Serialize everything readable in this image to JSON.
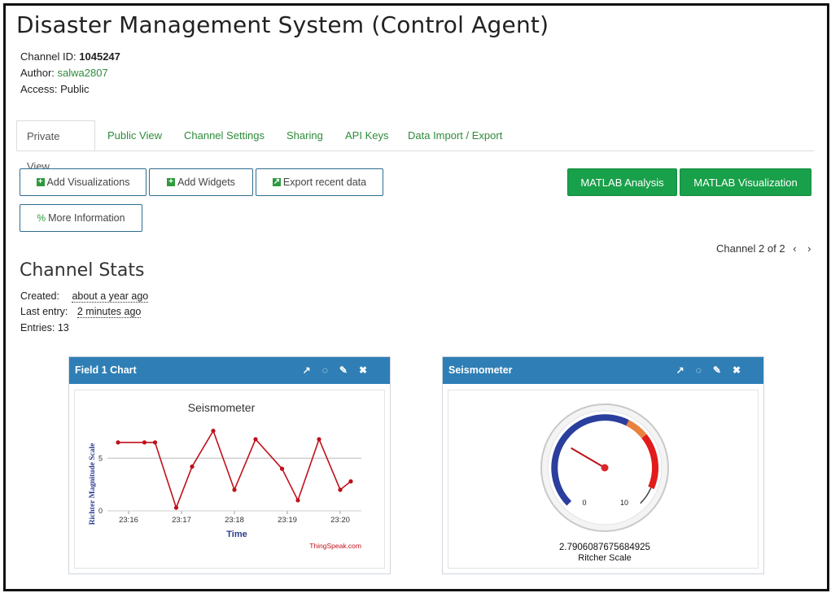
{
  "page": {
    "title": "Disaster Management System (Control Agent)",
    "channel_id_label": "Channel ID:",
    "channel_id": "1045247",
    "author_label": "Author:",
    "author": "salwa2807",
    "access": "Access: Public"
  },
  "tabs": [
    {
      "label": "Private View",
      "active": true
    },
    {
      "label": "Public View"
    },
    {
      "label": "Channel Settings"
    },
    {
      "label": "Sharing"
    },
    {
      "label": "API Keys"
    },
    {
      "label": "Data Import / Export"
    }
  ],
  "toolbar": {
    "add_visualizations": "Add Visualizations",
    "add_widgets": "Add Widgets",
    "export_recent": "Export recent data",
    "more_info": "More Information",
    "matlab_analysis": "MATLAB Analysis",
    "matlab_visualization": "MATLAB Visualization"
  },
  "channel_pager": "Channel 2 of 2",
  "stats": {
    "heading": "Channel Stats",
    "created_label": "Created:",
    "created": "about a year ago",
    "last_entry_label": "Last entry:",
    "last_entry": "2 minutes ago",
    "entries": "Entries: 13"
  },
  "field_chart_panel": {
    "title": "Field 1 Chart",
    "watermark": "ThingSpeak.com"
  },
  "gauge_panel": {
    "title": "Seismometer",
    "value_text": "2.7906087675684925",
    "unit": "Ritcher Scale",
    "min_label": "0",
    "max_label": "10"
  },
  "colors": {
    "accent_green": "#19a04a",
    "link_green": "#2e8b3a",
    "panel_header": "#2f7fb6",
    "line_red": "#c0101a"
  },
  "chart_data": [
    {
      "type": "line",
      "title": "Seismometer",
      "xlabel": "Time",
      "ylabel": "Richter Magnitude Scale",
      "x_ticks": [
        "23:16",
        "23:17",
        "23:18",
        "23:19",
        "23:20"
      ],
      "y_ticks": [
        "0",
        "5"
      ],
      "ylim": [
        0,
        8.5
      ],
      "series": [
        {
          "values": [
            {
              "t": "23:15.8",
              "y": 6.5
            },
            {
              "t": "23:16.3",
              "y": 6.5
            },
            {
              "t": "23:16.5",
              "y": 6.5
            },
            {
              "t": "23:16.9",
              "y": 0.3
            },
            {
              "t": "23:17.2",
              "y": 4.2
            },
            {
              "t": "23:17.6",
              "y": 7.6
            },
            {
              "t": "23:18.0",
              "y": 2.0
            },
            {
              "t": "23:18.4",
              "y": 6.8
            },
            {
              "t": "23:18.9",
              "y": 4.0
            },
            {
              "t": "23:19.2",
              "y": 1.0
            },
            {
              "t": "23:19.6",
              "y": 6.8
            },
            {
              "t": "23:20.0",
              "y": 2.0
            },
            {
              "t": "23:20.2",
              "y": 2.8
            }
          ]
        }
      ],
      "grid": true
    },
    {
      "type": "gauge",
      "min": 0,
      "max": 10,
      "value": 2.7906087675684925
    }
  ]
}
